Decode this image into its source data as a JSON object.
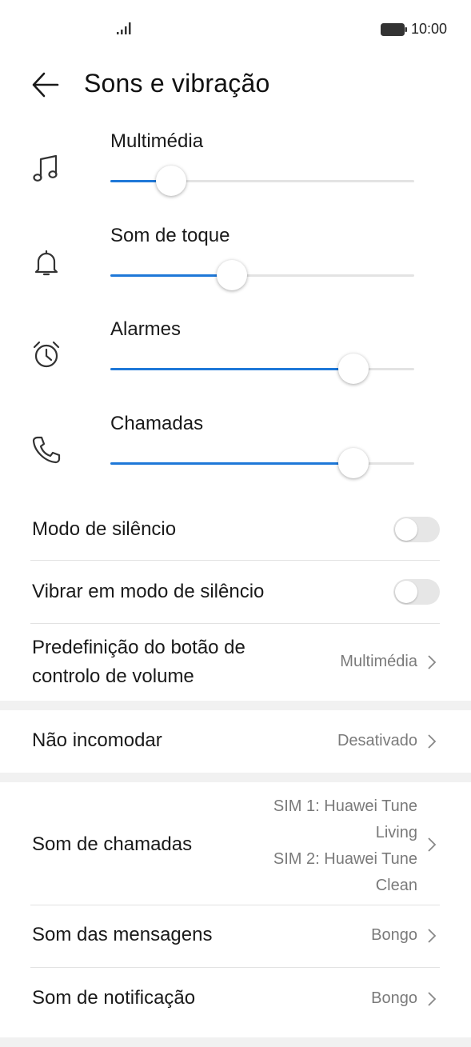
{
  "status": {
    "time": "10:00"
  },
  "header": {
    "title": "Sons e vibração"
  },
  "volumes": [
    {
      "label": "Multimédia",
      "icon": "music-note-icon",
      "level": 0.2
    },
    {
      "label": "Som de toque",
      "icon": "bell-icon",
      "level": 0.4
    },
    {
      "label": "Alarmes",
      "icon": "alarm-clock-icon",
      "level": 0.8
    },
    {
      "label": "Chamadas",
      "icon": "phone-icon",
      "level": 0.8
    }
  ],
  "settings": {
    "silent_mode": {
      "label": "Modo de silêncio",
      "on": false
    },
    "vibrate_silent": {
      "label": "Vibrar em modo de silêncio",
      "on": false
    },
    "volume_button": {
      "label_line1": "Predefinição do botão de",
      "label_line2": "controlo de volume",
      "value": "Multimédia"
    },
    "dnd": {
      "label": "Não incomodar",
      "value": "Desativado"
    },
    "ringtone": {
      "label": "Som de chamadas",
      "sim1_line1": "SIM 1: Huawei Tune",
      "sim1_line2": "Living",
      "sim2_line1": "SIM 2: Huawei Tune",
      "sim2_line2": "Clean"
    },
    "messages": {
      "label": "Som das mensagens",
      "value": "Bongo"
    },
    "notification": {
      "label": "Som de notificação",
      "value": "Bongo"
    }
  },
  "colors": {
    "accent": "#1e78d8",
    "track": "#e3e3e3",
    "toggle_off": "#e6e6e6",
    "secondary_text": "#7a7a7a"
  }
}
